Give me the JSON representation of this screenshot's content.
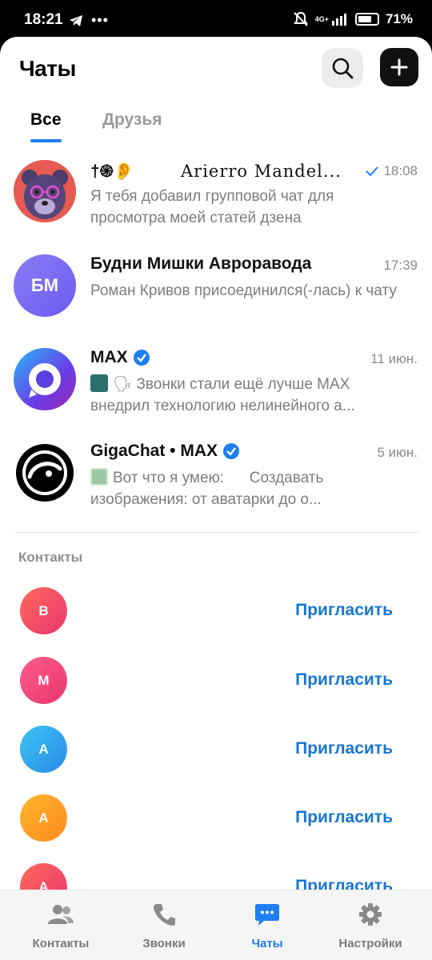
{
  "status_bar": {
    "time": "18:21",
    "network": "4G+",
    "battery": "71%",
    "battery_level": 0.71
  },
  "header": {
    "title": "Чаты",
    "search_icon": "search-icon",
    "add_icon": "plus-icon"
  },
  "tabs": [
    {
      "label": "Все",
      "active": true
    },
    {
      "label": "Друзья",
      "active": false
    }
  ],
  "chats": [
    {
      "name_emoji": "†֍👂",
      "name": "Arierro Mandel...",
      "time": "18:08",
      "read": true,
      "message": "Я тебя добавил групповой чат для просмотра моей статей дзена"
    },
    {
      "name": "Будни Мишки Авроравода",
      "initials": "БМ",
      "time": "17:39",
      "message": "Роман Кривов присоединился(-лась) к чату"
    },
    {
      "name": "MAX",
      "verified": true,
      "time": "11 июн.",
      "message_emoji": "🗣",
      "message": "Звонки стали ещё лучше MAX внедрил технологию нелинейного а..."
    },
    {
      "name": "GigaChat • MAX",
      "verified": true,
      "time": "5 июн.",
      "message": "Вот что я умею:      Создавать изображения: от аватарки до о..."
    }
  ],
  "contacts_section": {
    "label": "Контакты",
    "items": [
      {
        "initial": "В",
        "name": "",
        "action": "Пригласить",
        "color": "#f44a66"
      },
      {
        "initial": "М",
        "name": "",
        "action": "Пригласить",
        "color": "#f2497f"
      },
      {
        "initial": "А",
        "name": "",
        "action": "Пригласить",
        "color": "#33a6ec"
      },
      {
        "initial": "А",
        "name": "",
        "action": "Пригласить",
        "color": "#ffa21c"
      },
      {
        "initial": "А",
        "name": "",
        "action": "Пригласить",
        "color": "#f4506a"
      }
    ]
  },
  "bottom_nav": [
    {
      "label": "Контакты",
      "icon": "contacts-icon",
      "active": false
    },
    {
      "label": "Звонки",
      "icon": "phone-icon",
      "active": false
    },
    {
      "label": "Чаты",
      "icon": "chat-icon",
      "active": true
    },
    {
      "label": "Настройки",
      "icon": "gear-icon",
      "active": false
    }
  ],
  "colors": {
    "accent": "#1e7ff0",
    "link": "#1976d2",
    "secondary_text": "#7d7d7d"
  }
}
